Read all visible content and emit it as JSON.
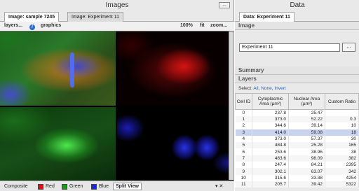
{
  "left": {
    "title": "Images",
    "dots": "...",
    "tabs": [
      {
        "label": "Image: sample 7245",
        "active": true
      },
      {
        "label": "Image: Experiment 11",
        "active": false
      }
    ],
    "toolbar": {
      "layers": "layers...",
      "graphics": "graphics",
      "zoom_pct": "100%",
      "fit": "fit",
      "zoom": "zoom..."
    },
    "bottom_tabs": [
      {
        "label": "Composite",
        "color": ""
      },
      {
        "label": "Red",
        "color": "#e01010"
      },
      {
        "label": "Green",
        "color": "#12a012"
      },
      {
        "label": "Blue",
        "color": "#1a28d8"
      },
      {
        "label": "Split View",
        "color": ""
      }
    ]
  },
  "right": {
    "title": "Data",
    "tab": "Data: Experiment 11",
    "image_section": "Image",
    "image_value": "Experiment 11",
    "browse": "...",
    "summary": "Summary",
    "layers": "Layers",
    "select_prefix": "Select:",
    "select_all": "All",
    "select_none": "None",
    "select_invert": "Invert",
    "columns": [
      "Cell ID",
      "Cytoplasmic Area (µm²)",
      "Nuclear Area (µm²)",
      "Custom Ratio"
    ],
    "rows": [
      [
        "0",
        "237.8",
        "25.47",
        ""
      ],
      [
        "1",
        "373.0",
        "52.22",
        "0.3"
      ],
      [
        "2",
        "344.6",
        "39.14",
        "10"
      ],
      [
        "3",
        "414.0",
        "59.08",
        "18"
      ],
      [
        "4",
        "373.0",
        "57.37",
        "30"
      ],
      [
        "5",
        "484.8",
        "25.28",
        "165"
      ],
      [
        "6",
        "253.6",
        "38.96",
        "38"
      ],
      [
        "7",
        "483.6",
        "98.09",
        "382"
      ],
      [
        "8",
        "247.4",
        "84.21",
        "2395"
      ],
      [
        "9",
        "302.1",
        "63.07",
        "342"
      ],
      [
        "10",
        "315.6",
        "33.38",
        "4254"
      ],
      [
        "11",
        "205.7",
        "39.42",
        "5322"
      ]
    ],
    "selected_row": 3
  }
}
